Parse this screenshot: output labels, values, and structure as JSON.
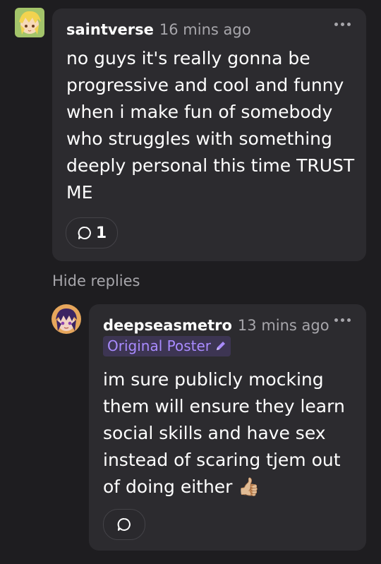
{
  "comment": {
    "username": "saintverse",
    "timestamp": "16 mins ago",
    "text": "no guys it's really gonna be\nprogressive and cool and funny\nwhen i make fun of somebody\nwho struggles with something\ndeeply personal this time TRUST\nME",
    "reply_count": "1",
    "icons": {
      "avatar": "avatar-blonde-anime-character",
      "more": "more-dots-icon",
      "reply": "speech-bubble-icon"
    }
  },
  "thread": {
    "hide_replies_label": "Hide replies"
  },
  "reply": {
    "username": "deepseasmetro",
    "timestamp": "13 mins ago",
    "badge_label": "Original Poster",
    "text": "im sure publicly mocking\nthem will ensure they learn\nsocial skills and have sex\ninstead of scaring tjem out\nof doing either ",
    "emoji": "👍🏼",
    "icons": {
      "avatar": "avatar-purple-hair-character",
      "badge": "pencil-icon",
      "more": "more-dots-icon",
      "reply": "speech-bubble-icon"
    }
  },
  "colors": {
    "background": "#1e1d20",
    "card": "#2c2b2f",
    "muted_text": "#a7a6ab",
    "badge_bg": "#3d3553",
    "badge_text": "#a98bff"
  }
}
